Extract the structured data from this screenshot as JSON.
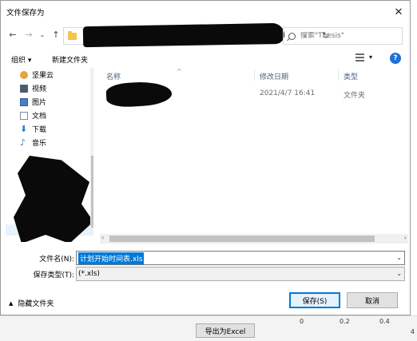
{
  "dialog": {
    "title": "文件保存为",
    "close_glyph": "✕"
  },
  "nav": {
    "back_glyph": "←",
    "forward_glyph": "→",
    "recent_glyph": "⌄",
    "up_glyph": "↑",
    "dropdown_glyph": "⌄",
    "refresh_glyph": "↻"
  },
  "search": {
    "placeholder": "搜索\"Thesis\""
  },
  "toolbar": {
    "organize": "组织 ▾",
    "new_folder": "新建文件夹",
    "view_dd": "▾",
    "help": "?"
  },
  "sidebar": {
    "items": [
      {
        "label": "坚果云",
        "icon": "jianguoyun-icon",
        "color": "#e8a33c"
      },
      {
        "label": "视频",
        "icon": "video-icon",
        "color": "#4a5a70"
      },
      {
        "label": "图片",
        "icon": "pictures-icon",
        "color": "#4a7ec8"
      },
      {
        "label": "文档",
        "icon": "documents-icon",
        "color": "#7a8ca8"
      },
      {
        "label": "下载",
        "icon": "download-icon",
        "color": "#2a7ad6"
      },
      {
        "label": "音乐",
        "icon": "music-icon",
        "color": "#2a7ad6"
      }
    ]
  },
  "filelist": {
    "columns": {
      "name": "名称",
      "modified": "修改日期",
      "type": "类型"
    },
    "sort_glyph": "^",
    "rows": [
      {
        "modified": "2021/4/7 16:41",
        "type": "文件夹"
      }
    ],
    "scroll_left": "‹",
    "scroll_right": "›"
  },
  "form": {
    "filename_label": "文件名(N):",
    "filename_value": "计划开始时间表.xls",
    "filetype_label": "保存类型(T):",
    "filetype_value": "(*.xls)",
    "dd_glyph": "⌄"
  },
  "footer": {
    "hide_folders": "隐藏文件夹",
    "caret": "▲",
    "save": "保存(S)",
    "cancel": "取消"
  },
  "background": {
    "export_button": "导出为Excel",
    "ticks": [
      "0",
      "0.2",
      "0.4"
    ],
    "right_tick": "4",
    "right_tick_top": "0"
  }
}
